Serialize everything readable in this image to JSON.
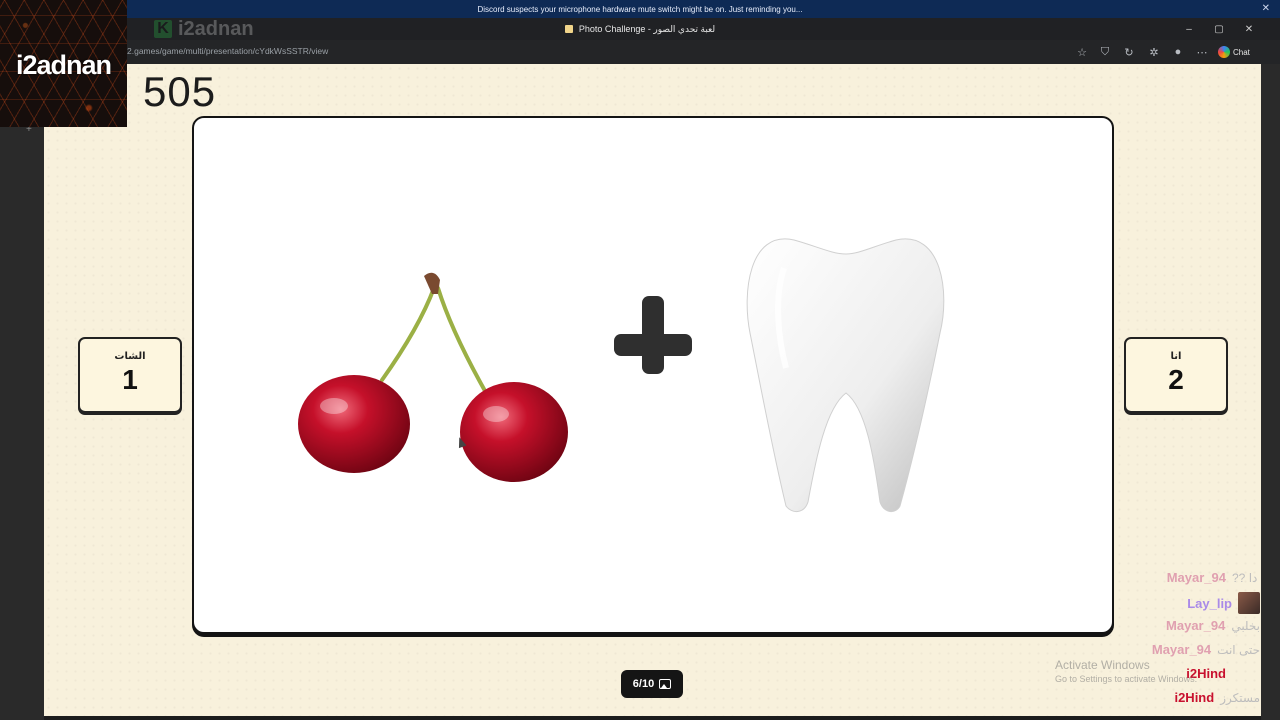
{
  "notification": {
    "text": "Discord suspects your microphone hardware mute switch might be on. Just reminding you..."
  },
  "window": {
    "title": "Photo Challenge - لعبة تحدي الصور"
  },
  "browser": {
    "url": "2.games/game/multi/presentation/cYdkWsSSTR/view",
    "chat_label": "Chat"
  },
  "streamer": {
    "name": "i2adnan",
    "brand_text": "i2adnan"
  },
  "game": {
    "score": "505",
    "left_team": {
      "label": "الشات",
      "points": "1"
    },
    "right_team": {
      "label": "انا",
      "points": "2"
    },
    "counter": "6/10"
  },
  "chat": [
    {
      "user": "Mayar_94",
      "text": "?? دا",
      "color": "#e0a0b0"
    },
    {
      "user": "Lay_lip",
      "text": "",
      "color": "#a98ae8",
      "avatar": true
    },
    {
      "user": "Mayar_94",
      "text": "بخلبي",
      "color": "#e0a0b0"
    },
    {
      "user": "Mayar_94",
      "text": "حتى انت",
      "color": "#e0a0b0"
    },
    {
      "user": "i2Hind",
      "text": "",
      "color": "#c8102e"
    },
    {
      "user": "i2Hind",
      "text": "مستكرز",
      "color": "#c8102e"
    }
  ],
  "watermark": {
    "title": "Activate Windows",
    "subtitle": "Go to Settings to activate Windows."
  }
}
